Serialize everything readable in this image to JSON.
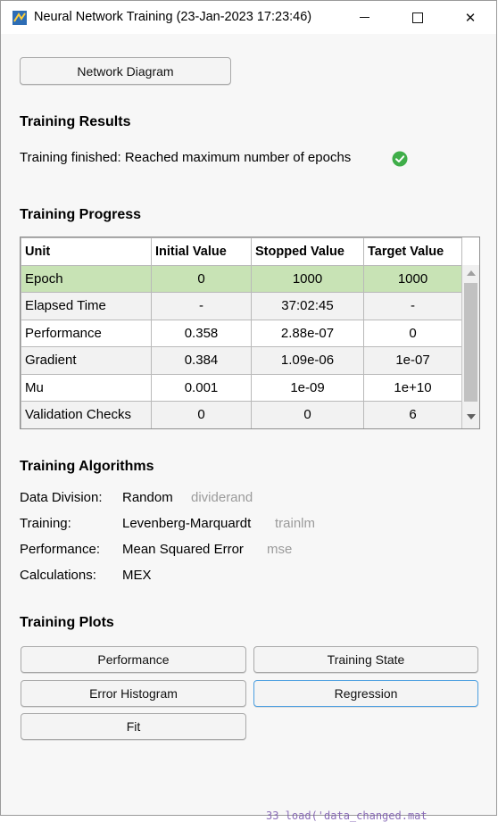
{
  "window": {
    "title": "Neural Network Training (23-Jan-2023 17:23:46)",
    "close_glyph": "✕"
  },
  "toolbar": {
    "network_diagram_label": "Network Diagram"
  },
  "training_results": {
    "heading": "Training Results",
    "status_text": "Training finished: Reached maximum number of epochs",
    "status_icon": "check-circle-icon",
    "status_color": "#3fae49"
  },
  "training_progress": {
    "heading": "Training Progress",
    "columns": [
      "Unit",
      "Initial Value",
      "Stopped Value",
      "Target Value"
    ],
    "rows": [
      [
        "Epoch",
        "0",
        "1000",
        "1000"
      ],
      [
        "Elapsed Time",
        "-",
        "37:02:45",
        "-"
      ],
      [
        "Performance",
        "0.358",
        "2.88e-07",
        "0"
      ],
      [
        "Gradient",
        "0.384",
        "1.09e-06",
        "1e-07"
      ],
      [
        "Mu",
        "0.001",
        "1e-09",
        "1e+10"
      ],
      [
        "Validation Checks",
        "0",
        "0",
        "6"
      ]
    ],
    "selected_row_color": "#c8e3b5"
  },
  "training_algorithms": {
    "heading": "Training Algorithms",
    "items": [
      {
        "label": "Data Division:",
        "value": "Random",
        "code": "dividerand"
      },
      {
        "label": "Training:",
        "value": "Levenberg-Marquardt",
        "code": "trainlm"
      },
      {
        "label": "Performance:",
        "value": "Mean Squared Error",
        "code": "mse"
      },
      {
        "label": "Calculations:",
        "value": "MEX",
        "code": ""
      }
    ]
  },
  "training_plots": {
    "heading": "Training Plots",
    "buttons": [
      "Performance",
      "Training State",
      "Error Histogram",
      "Regression",
      "Fit"
    ]
  },
  "background": {
    "code_fragment": "33  load('data_changed.mat"
  }
}
